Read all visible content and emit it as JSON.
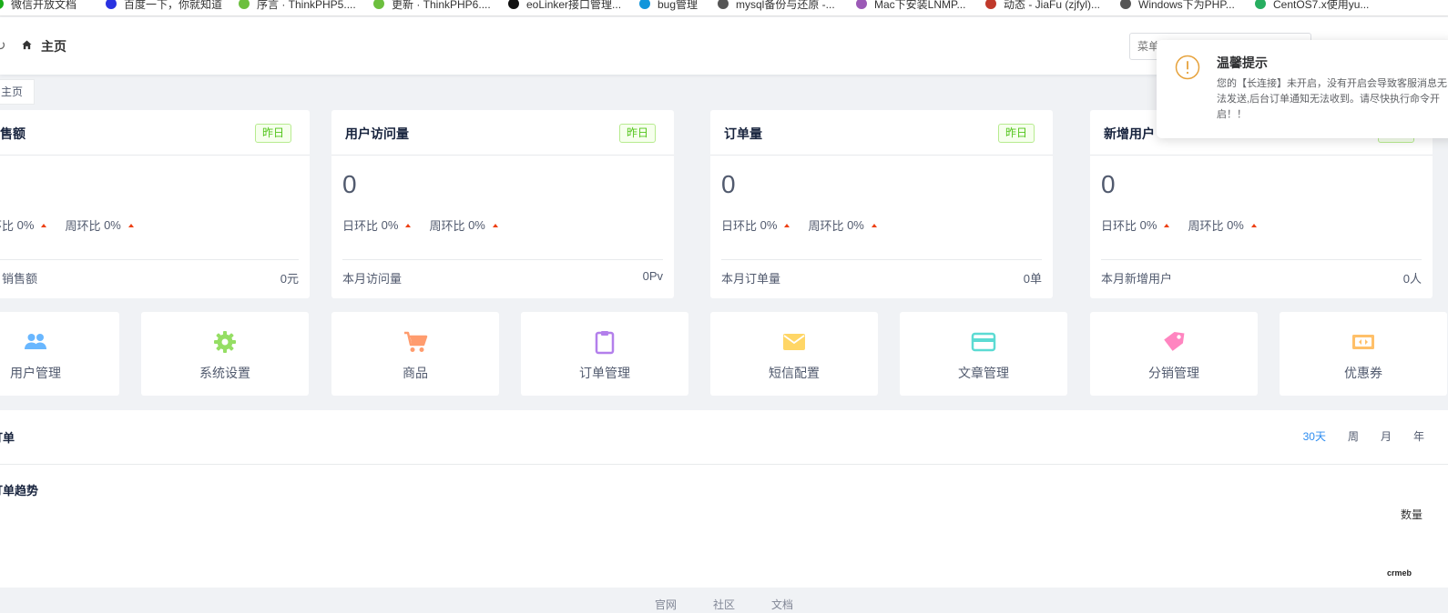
{
  "bookmarks": [
    {
      "label": "微信开放文档",
      "color": "#1aad19"
    },
    {
      "label": "百度一下，你就知道",
      "color": "#2932e1"
    },
    {
      "label": "序言 · ThinkPHP5....",
      "color": "#6cbf3e"
    },
    {
      "label": "更新 · ThinkPHP6....",
      "color": "#6cbf3e"
    },
    {
      "label": "eoLinker接口管理...",
      "color": "#111111"
    },
    {
      "label": "bug管理",
      "color": "#1296db"
    },
    {
      "label": "mysql备份与还原 -...",
      "color": "#555555"
    },
    {
      "label": "Mac下安装LNMP...",
      "color": "#9b59b6"
    },
    {
      "label": "动态 - JiaFu (zjfyl)...",
      "color": "#c0392b"
    },
    {
      "label": "Windows下为PHP...",
      "color": "#555555"
    },
    {
      "label": "CentOS7.x使用yu...",
      "color": "#27ae60"
    }
  ],
  "header": {
    "refresh_icon": "↻",
    "title": "主页",
    "search_placeholder": "菜单"
  },
  "tabs": [
    {
      "label": "主页"
    }
  ],
  "cards": [
    {
      "title": "销售额",
      "tag": "昨日",
      "value": "",
      "day_ratio_label": "日环比",
      "day_ratio": "0%",
      "week_ratio_label": "周环比",
      "week_ratio": "0%",
      "footer_label": "本月销售额",
      "footer_value": "0元"
    },
    {
      "title": "用户访问量",
      "tag": "昨日",
      "value": "0",
      "day_ratio_label": "日环比",
      "day_ratio": "0%",
      "week_ratio_label": "周环比",
      "week_ratio": "0%",
      "footer_label": "本月访问量",
      "footer_value": "0Pv"
    },
    {
      "title": "订单量",
      "tag": "昨日",
      "value": "0",
      "day_ratio_label": "日环比",
      "day_ratio": "0%",
      "week_ratio_label": "周环比",
      "week_ratio": "0%",
      "footer_label": "本月订单量",
      "footer_value": "0单"
    },
    {
      "title": "新增用户",
      "tag": "昨日",
      "value": "0",
      "day_ratio_label": "日环比",
      "day_ratio": "0%",
      "week_ratio_label": "周环比",
      "week_ratio": "0%",
      "footer_label": "本月新增用户",
      "footer_value": "0人"
    }
  ],
  "shortcuts": [
    {
      "label": "用户管理",
      "icon": "users-icon",
      "color": "#69b7ff"
    },
    {
      "label": "系统设置",
      "icon": "gear-icon",
      "color": "#95de64"
    },
    {
      "label": "商品",
      "icon": "cart-icon",
      "color": "#ff9c6e"
    },
    {
      "label": "订单管理",
      "icon": "clipboard-icon",
      "color": "#b37feb"
    },
    {
      "label": "短信配置",
      "icon": "envelope-icon",
      "color": "#ffd666"
    },
    {
      "label": "文章管理",
      "icon": "card-icon",
      "color": "#5cdbd3"
    },
    {
      "label": "分销管理",
      "icon": "tag-icon",
      "color": "#ff85c0"
    },
    {
      "label": "优惠券",
      "icon": "ticket-icon",
      "color": "#ffc069"
    }
  ],
  "order_panel": {
    "title": "订单",
    "periods": [
      "30天",
      "周",
      "月",
      "年"
    ],
    "active_period": "30天",
    "subtitle": "订单趋势",
    "y_label": "数量",
    "watermark": "crmeb"
  },
  "footer": {
    "links": [
      "官网",
      "社区",
      "文档"
    ]
  },
  "notification": {
    "title": "温馨提示",
    "message": "您的【长连接】未开启，没有开启会导致客服消息无法发送,后台订单通知无法收到。请尽快执行命令开启！！",
    "color": "#e6a23c"
  }
}
